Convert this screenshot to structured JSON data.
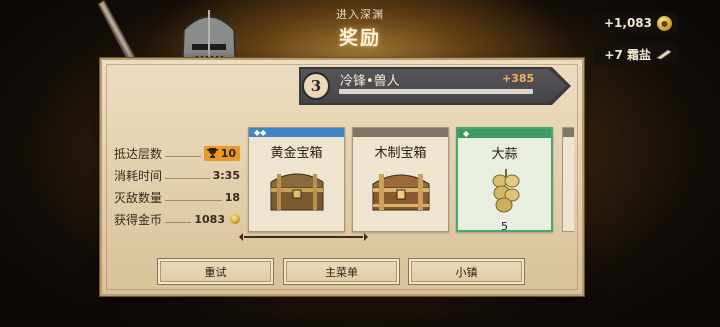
{
  "header": {
    "subtitle": "进入深渊",
    "title": "奖励"
  },
  "currency": {
    "coins": "+1,083",
    "salt": "+7 霜盐"
  },
  "enemy": {
    "level": "3",
    "name": "冷锋•兽人",
    "score": "+385"
  },
  "stats": [
    {
      "label": "抵达层数",
      "value": "10"
    },
    {
      "label": "消耗时间",
      "value": "3:35"
    },
    {
      "label": "灭敌数量",
      "value": "18"
    },
    {
      "label": "获得金币",
      "value": "1083"
    }
  ],
  "rewards": [
    {
      "name": "黄金宝箱",
      "strip_color": "#3f86c4",
      "rarity_marks": "◆◆",
      "count": ""
    },
    {
      "name": "木制宝箱",
      "strip_color": "#7f7668",
      "rarity_marks": "",
      "count": ""
    },
    {
      "name": "大蒜",
      "strip_color": "#3f9a62",
      "rarity_marks": "◆",
      "count": "5"
    }
  ],
  "buttons": {
    "retry": "重试",
    "main_menu": "主菜单",
    "town": "小镇"
  }
}
